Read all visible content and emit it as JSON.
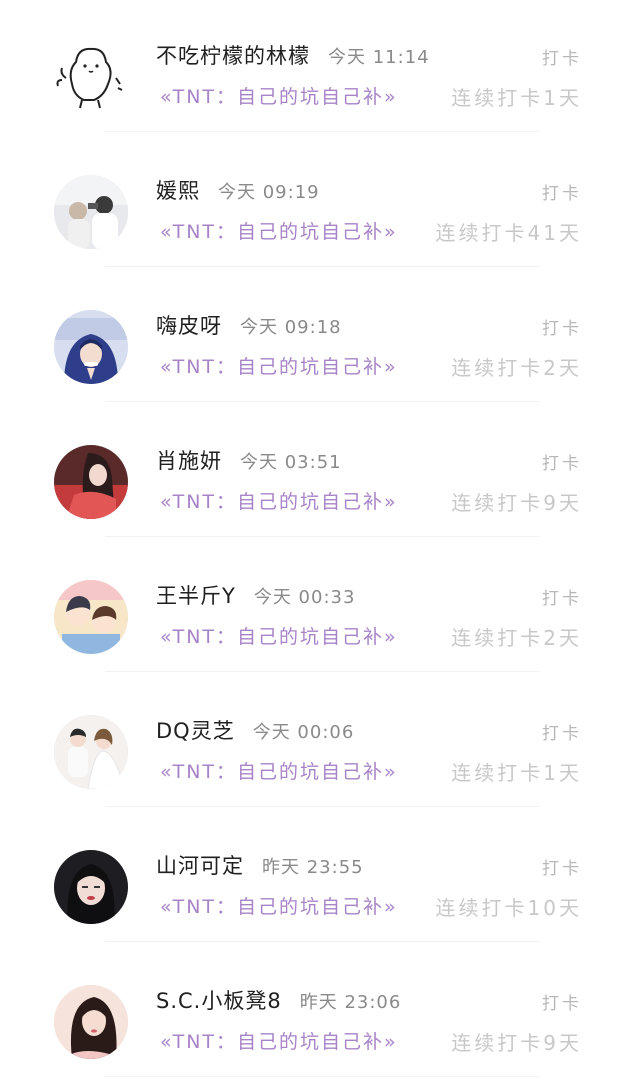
{
  "checkins": [
    {
      "name": "不吃柠檬的林檬",
      "time": "今天 11:14",
      "action": "打卡",
      "topic": "«TNT：自己的坑自己补»",
      "streak": "连续打卡1天",
      "avatar_icon": "doodle-bear-icon"
    },
    {
      "name": "媛熙",
      "time": "今天 09:19",
      "action": "打卡",
      "topic": "«TNT：自己的坑自己补»",
      "streak": "连续打卡41天",
      "avatar_icon": "user-photo-avatar"
    },
    {
      "name": "嗨皮呀",
      "time": "今天 09:18",
      "action": "打卡",
      "topic": "«TNT：自己的坑自己补»",
      "streak": "连续打卡2天",
      "avatar_icon": "user-photo-avatar"
    },
    {
      "name": "肖施妍",
      "time": "今天 03:51",
      "action": "打卡",
      "topic": "«TNT：自己的坑自己补»",
      "streak": "连续打卡9天",
      "avatar_icon": "user-photo-avatar"
    },
    {
      "name": "王半斤Y",
      "time": "今天 00:33",
      "action": "打卡",
      "topic": "«TNT：自己的坑自己补»",
      "streak": "连续打卡2天",
      "avatar_icon": "user-photo-avatar"
    },
    {
      "name": "DQ灵芝",
      "time": "今天 00:06",
      "action": "打卡",
      "topic": "«TNT：自己的坑自己补»",
      "streak": "连续打卡1天",
      "avatar_icon": "user-photo-avatar"
    },
    {
      "name": "山河可定",
      "time": "昨天 23:55",
      "action": "打卡",
      "topic": "«TNT：自己的坑自己补»",
      "streak": "连续打卡10天",
      "avatar_icon": "user-photo-avatar"
    },
    {
      "name": "S.C.小板凳8",
      "time": "昨天 23:06",
      "action": "打卡",
      "topic": "«TNT：自己的坑自己补»",
      "streak": "连续打卡9天",
      "avatar_icon": "user-photo-avatar"
    }
  ],
  "colors": {
    "topic": "#a783c8",
    "action": "#b8b8b8",
    "streak": "#c8c8c8",
    "time": "#8a8a8a",
    "name": "#202020",
    "divider": "#f2f2f2"
  }
}
